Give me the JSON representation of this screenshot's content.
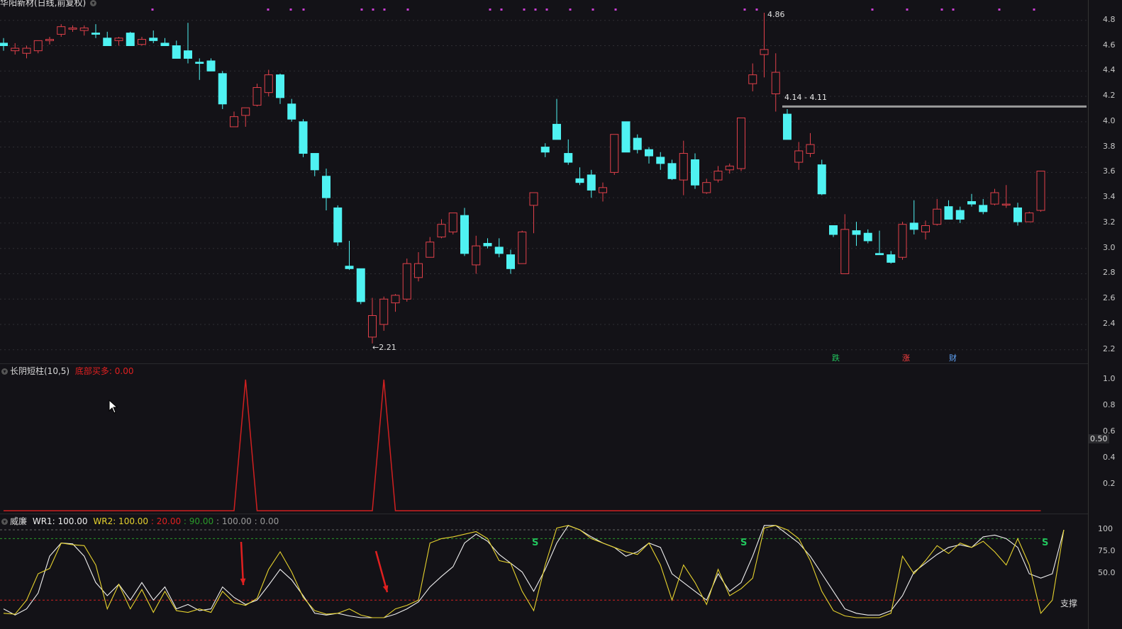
{
  "main_panel": {
    "title": "华阳新材(日线,前复权)",
    "high_label": "4.86",
    "low_label": "←2.21",
    "range_label": "4.14 - 4.11",
    "markers": [
      {
        "text": "跌",
        "color": "#22c55e"
      },
      {
        "text": "涨",
        "color": "#ff4040"
      },
      {
        "text": "财",
        "color": "#60a5fa"
      }
    ],
    "y_ticks": [
      "4.8",
      "4.6",
      "4.4",
      "4.2",
      "4.0",
      "3.8",
      "3.6",
      "3.4",
      "3.2",
      "3.0",
      "2.8",
      "2.6",
      "2.4",
      "2.2"
    ]
  },
  "ind1_panel": {
    "name": "长阴短柱(10,5)",
    "value_label": "底部买多: 0.00",
    "y_ticks": [
      "1.0",
      "0.8",
      "0.6",
      "0.4",
      "0.2"
    ],
    "cursor_value": "0.50"
  },
  "ind2_panel": {
    "name": "威廉",
    "wr1_label": "WR1: 100.00",
    "wr2_label": "WR2: 100.00",
    "lvl_a": ": 20.00",
    "lvl_b": ": 90.00",
    "lvl_c": ": 100.00",
    "lvl_d": ": 0.00",
    "s_mark": "S",
    "support_label": "支撑",
    "y_ticks": [
      "100",
      "75.0",
      "50.0"
    ]
  },
  "colors": {
    "up": "#e0404a",
    "down": "#4ff2f2",
    "wr1": "#f0f0f0",
    "wr2": "#e6d22e",
    "signal": "#d02020",
    "magenta": "#c93fd3"
  },
  "chart_data": [
    {
      "type": "candlestick",
      "title": "华阳新材(日线,前复权)",
      "ylim": [
        2.14,
        4.9
      ],
      "candles": [
        [
          4.62,
          4.66,
          4.56,
          4.6
        ],
        [
          4.56,
          4.62,
          4.53,
          4.58
        ],
        [
          4.54,
          4.6,
          4.5,
          4.58
        ],
        [
          4.56,
          4.64,
          4.54,
          4.64
        ],
        [
          4.64,
          4.67,
          4.61,
          4.65
        ],
        [
          4.69,
          4.77,
          4.67,
          4.75
        ],
        [
          4.73,
          4.76,
          4.71,
          4.74
        ],
        [
          4.72,
          4.76,
          4.68,
          4.74
        ],
        [
          4.7,
          4.77,
          4.66,
          4.69
        ],
        [
          4.66,
          4.71,
          4.6,
          4.6
        ],
        [
          4.64,
          4.67,
          4.6,
          4.66
        ],
        [
          4.7,
          4.71,
          4.6,
          4.6
        ],
        [
          4.61,
          4.67,
          4.6,
          4.65
        ],
        [
          4.66,
          4.72,
          4.62,
          4.64
        ],
        [
          4.62,
          4.66,
          4.6,
          4.6
        ],
        [
          4.6,
          4.64,
          4.5,
          4.5
        ],
        [
          4.56,
          4.78,
          4.46,
          4.5
        ],
        [
          4.47,
          4.5,
          4.33,
          4.46
        ],
        [
          4.48,
          4.5,
          4.4,
          4.4
        ],
        [
          4.38,
          4.4,
          4.1,
          4.14
        ],
        [
          3.96,
          4.08,
          3.96,
          4.04
        ],
        [
          4.05,
          4.1,
          3.96,
          4.11
        ],
        [
          4.13,
          4.3,
          4.12,
          4.27
        ],
        [
          4.23,
          4.41,
          4.2,
          4.37
        ],
        [
          4.37,
          4.38,
          4.14,
          4.19
        ],
        [
          4.14,
          4.18,
          4.0,
          4.02
        ],
        [
          4.0,
          4.02,
          3.72,
          3.75
        ],
        [
          3.75,
          3.75,
          3.57,
          3.62
        ],
        [
          3.57,
          3.63,
          3.3,
          3.4
        ],
        [
          3.32,
          3.34,
          3.02,
          3.05
        ],
        [
          2.86,
          3.06,
          2.83,
          2.84
        ],
        [
          2.84,
          2.84,
          2.56,
          2.58
        ],
        [
          2.3,
          2.61,
          2.25,
          2.47
        ],
        [
          2.4,
          2.62,
          2.35,
          2.6
        ],
        [
          2.57,
          2.64,
          2.5,
          2.63
        ],
        [
          2.6,
          2.92,
          2.58,
          2.88
        ],
        [
          2.77,
          2.97,
          2.74,
          2.88
        ],
        [
          2.93,
          3.09,
          2.93,
          3.05
        ],
        [
          3.09,
          3.23,
          3.08,
          3.19
        ],
        [
          3.13,
          3.28,
          3.11,
          3.28
        ],
        [
          3.26,
          3.32,
          2.94,
          2.96
        ],
        [
          2.87,
          3.1,
          2.8,
          3.02
        ],
        [
          3.04,
          3.08,
          3.0,
          3.02
        ],
        [
          3.01,
          3.08,
          2.93,
          2.96
        ],
        [
          2.95,
          2.99,
          2.8,
          2.84
        ],
        [
          2.88,
          3.14,
          2.88,
          3.13
        ],
        [
          3.34,
          3.44,
          3.12,
          3.44
        ],
        [
          3.8,
          3.83,
          3.72,
          3.76
        ],
        [
          3.98,
          4.18,
          3.86,
          3.86
        ],
        [
          3.75,
          3.86,
          3.66,
          3.68
        ],
        [
          3.55,
          3.64,
          3.5,
          3.52
        ],
        [
          3.58,
          3.62,
          3.4,
          3.46
        ],
        [
          3.44,
          3.52,
          3.37,
          3.48
        ],
        [
          3.6,
          3.9,
          3.58,
          3.9
        ],
        [
          4.0,
          4.0,
          3.76,
          3.76
        ],
        [
          3.87,
          3.9,
          3.75,
          3.78
        ],
        [
          3.78,
          3.8,
          3.67,
          3.73
        ],
        [
          3.72,
          3.76,
          3.62,
          3.67
        ],
        [
          3.67,
          3.7,
          3.54,
          3.55
        ],
        [
          3.54,
          3.85,
          3.42,
          3.75
        ],
        [
          3.7,
          3.75,
          3.47,
          3.5
        ],
        [
          3.44,
          3.55,
          3.43,
          3.52
        ],
        [
          3.54,
          3.65,
          3.52,
          3.61
        ],
        [
          3.62,
          3.67,
          3.59,
          3.65
        ],
        [
          3.63,
          4.02,
          3.61,
          4.03
        ],
        [
          4.3,
          4.46,
          4.24,
          4.37
        ],
        [
          4.53,
          4.86,
          4.35,
          4.57
        ],
        [
          4.22,
          4.54,
          4.08,
          4.39
        ],
        [
          4.06,
          4.1,
          3.86,
          3.86
        ],
        [
          3.68,
          3.84,
          3.62,
          3.77
        ],
        [
          3.75,
          3.91,
          3.72,
          3.82
        ],
        [
          3.66,
          3.7,
          3.42,
          3.43
        ],
        [
          3.18,
          3.18,
          3.09,
          3.11
        ],
        [
          2.8,
          3.27,
          2.8,
          3.15
        ],
        [
          3.14,
          3.21,
          3.02,
          3.11
        ],
        [
          3.12,
          3.15,
          3.04,
          3.06
        ],
        [
          2.96,
          3.14,
          2.95,
          2.95
        ],
        [
          2.95,
          2.98,
          2.88,
          2.89
        ],
        [
          2.93,
          3.21,
          2.91,
          3.19
        ],
        [
          3.2,
          3.38,
          3.11,
          3.15
        ],
        [
          3.13,
          3.22,
          3.07,
          3.18
        ],
        [
          3.19,
          3.39,
          3.18,
          3.31
        ],
        [
          3.33,
          3.38,
          3.23,
          3.23
        ],
        [
          3.3,
          3.33,
          3.2,
          3.23
        ],
        [
          3.37,
          3.43,
          3.33,
          3.35
        ],
        [
          3.34,
          3.39,
          3.27,
          3.29
        ],
        [
          3.35,
          3.47,
          3.34,
          3.44
        ],
        [
          3.35,
          3.5,
          3.32,
          3.35
        ],
        [
          3.32,
          3.36,
          3.18,
          3.21
        ],
        [
          3.21,
          3.29,
          3.21,
          3.28
        ],
        [
          3.3,
          3.6,
          3.29,
          3.61
        ]
      ],
      "horizontal_line": 4.12,
      "y_ticks": [
        4.8,
        4.6,
        4.4,
        4.2,
        4.0,
        3.8,
        3.6,
        3.4,
        3.2,
        3.0,
        2.8,
        2.6,
        2.4,
        2.2
      ]
    },
    {
      "type": "line",
      "name": "长阴短柱(10,5)",
      "ylim": [
        0,
        1.05
      ],
      "peaks_at_index": [
        21,
        33
      ],
      "y_ticks": [
        1.0,
        0.8,
        0.6,
        0.4,
        0.2
      ]
    },
    {
      "type": "line",
      "name": "威廉",
      "ylim": [
        0,
        100
      ],
      "series": [
        {
          "name": "WR1",
          "values": [
            10,
            3,
            10,
            28,
            70,
            85,
            84,
            70,
            40,
            25,
            38,
            20,
            40,
            20,
            35,
            10,
            15,
            8,
            10,
            35,
            23,
            15,
            20,
            37,
            55,
            43,
            25,
            5,
            3,
            5,
            2,
            0,
            0,
            0,
            4,
            10,
            18,
            35,
            47,
            58,
            85,
            95,
            87,
            72,
            62,
            52,
            30,
            55,
            85,
            105,
            100,
            92,
            85,
            80,
            70,
            75,
            85,
            80,
            50,
            40,
            30,
            20,
            50,
            30,
            40,
            70,
            105,
            105,
            95,
            85,
            70,
            50,
            30,
            10,
            5,
            3,
            3,
            8,
            25,
            52,
            62,
            72,
            80,
            83,
            80,
            92,
            94,
            90,
            80,
            50,
            45,
            50,
            100
          ]
        },
        {
          "name": "WR2",
          "values": [
            5,
            4,
            20,
            50,
            56,
            85,
            83,
            82,
            60,
            10,
            38,
            10,
            32,
            6,
            30,
            8,
            6,
            10,
            6,
            30,
            17,
            14,
            22,
            55,
            75,
            52,
            23,
            8,
            4,
            5,
            10,
            3,
            0,
            0,
            10,
            14,
            20,
            85,
            90,
            92,
            95,
            98,
            90,
            65,
            62,
            30,
            8,
            60,
            102,
            105,
            100,
            90,
            85,
            80,
            75,
            72,
            85,
            60,
            20,
            60,
            40,
            15,
            55,
            25,
            33,
            45,
            102,
            105,
            100,
            90,
            65,
            30,
            8,
            2,
            0,
            0,
            0,
            5,
            70,
            50,
            65,
            82,
            73,
            85,
            80,
            87,
            75,
            60,
            90,
            60,
            5,
            20,
            100
          ]
        }
      ],
      "y_ticks": [
        100,
        75.0,
        50.0
      ]
    }
  ]
}
